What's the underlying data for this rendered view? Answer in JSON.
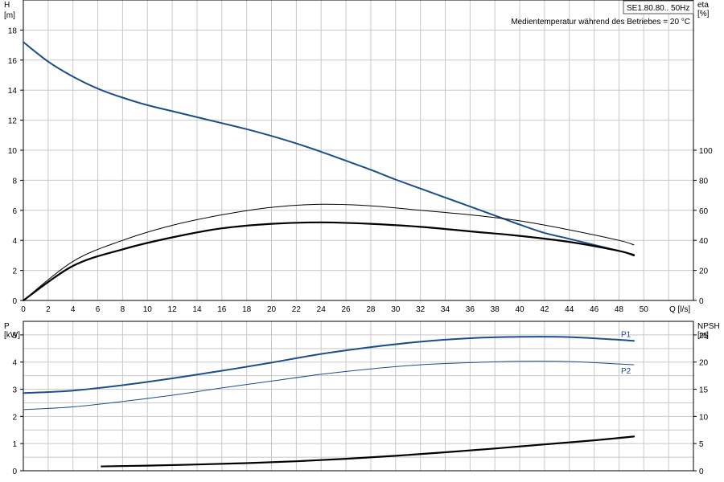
{
  "header": {
    "model": "SE1.80.80.. 50Hz",
    "note": "Medientemperatur während des Betriebes = 20 °C"
  },
  "colors": {
    "blue": "#1a4e8a",
    "black": "#000000",
    "grid": "#c8c8c8"
  },
  "chart_data": [
    {
      "type": "line",
      "xlabel": "Q [l/s]",
      "xticks": [
        0,
        2,
        4,
        6,
        8,
        10,
        12,
        14,
        16,
        18,
        20,
        22,
        24,
        26,
        28,
        30,
        32,
        34,
        36,
        38,
        40,
        42,
        44,
        46,
        48,
        50
      ],
      "xlim": [
        0,
        54
      ],
      "left_axis": {
        "label": "H",
        "unit": "[m]",
        "ylim": [
          0,
          20
        ],
        "ticks": [
          0,
          2,
          4,
          6,
          8,
          10,
          12,
          14,
          16,
          18
        ]
      },
      "right_axis": {
        "label": "eta",
        "unit": "[%]",
        "ylim": [
          0,
          200
        ],
        "ticks": [
          0,
          20,
          40,
          60,
          80,
          100
        ]
      },
      "series": [
        {
          "id": "H",
          "axis": "left",
          "color": "#1a4e8a",
          "width": 2,
          "x": [
            0,
            2,
            4,
            6,
            8,
            10,
            12,
            14,
            16,
            18,
            20,
            22,
            24,
            26,
            28,
            30,
            32,
            34,
            36,
            38,
            40,
            42,
            44,
            46,
            48,
            49.2
          ],
          "y": [
            17.2,
            15.9,
            14.9,
            14.1,
            13.5,
            13.0,
            12.6,
            12.2,
            11.8,
            11.4,
            10.95,
            10.45,
            9.9,
            9.3,
            8.7,
            8.05,
            7.45,
            6.85,
            6.25,
            5.65,
            5.05,
            4.5,
            4.1,
            3.7,
            3.3,
            3.05
          ]
        },
        {
          "id": "eta_thin",
          "axis": "right",
          "color": "#000000",
          "width": 1,
          "x": [
            0,
            4,
            8,
            12,
            16,
            20,
            24,
            28,
            32,
            36,
            40,
            44,
            48,
            49.2
          ],
          "y": [
            0,
            26,
            40,
            50,
            57,
            62,
            64,
            63,
            60,
            57,
            53,
            47,
            40,
            37
          ]
        },
        {
          "id": "eta_thick",
          "axis": "right",
          "color": "#000000",
          "width": 2.2,
          "x": [
            0,
            4,
            8,
            12,
            16,
            20,
            24,
            28,
            32,
            36,
            40,
            44,
            48,
            49.2
          ],
          "y": [
            0,
            23,
            34,
            42,
            48,
            51,
            52,
            51,
            49,
            46,
            43,
            39,
            33,
            30
          ]
        }
      ]
    },
    {
      "type": "line",
      "xlim": [
        0,
        54
      ],
      "left_axis": {
        "label": "P",
        "unit": "[kW]",
        "ylim": [
          0,
          5.5
        ],
        "ticks": [
          0,
          1,
          2,
          3,
          4,
          5
        ]
      },
      "right_axis": {
        "label": "NPSH",
        "unit": "[m]",
        "ylim": [
          0,
          27.5
        ],
        "ticks": [
          0,
          5,
          10,
          15,
          20,
          25
        ]
      },
      "series": [
        {
          "id": "P1",
          "name": "P1",
          "axis": "left",
          "color": "#1a4e8a",
          "width": 2,
          "x": [
            0,
            4,
            8,
            12,
            16,
            20,
            24,
            28,
            32,
            36,
            40,
            44,
            48,
            49.2
          ],
          "y": [
            2.86,
            2.95,
            3.15,
            3.4,
            3.68,
            3.98,
            4.3,
            4.55,
            4.75,
            4.88,
            4.93,
            4.92,
            4.82,
            4.78
          ]
        },
        {
          "id": "P2",
          "name": "P2",
          "axis": "left",
          "color": "#1a4e8a",
          "width": 1,
          "x": [
            0,
            4,
            8,
            12,
            16,
            20,
            24,
            28,
            32,
            36,
            40,
            44,
            48,
            49.2
          ],
          "y": [
            2.25,
            2.35,
            2.55,
            2.78,
            3.05,
            3.3,
            3.55,
            3.75,
            3.9,
            3.98,
            4.03,
            4.02,
            3.93,
            3.9
          ]
        },
        {
          "id": "NPSH",
          "axis": "right",
          "color": "#000000",
          "width": 2.2,
          "x": [
            6.3,
            10,
            14,
            18,
            22,
            26,
            30,
            34,
            38,
            42,
            46,
            49.2
          ],
          "y": [
            0.8,
            0.95,
            1.15,
            1.4,
            1.75,
            2.2,
            2.75,
            3.4,
            4.1,
            4.85,
            5.6,
            6.3
          ]
        }
      ]
    }
  ]
}
